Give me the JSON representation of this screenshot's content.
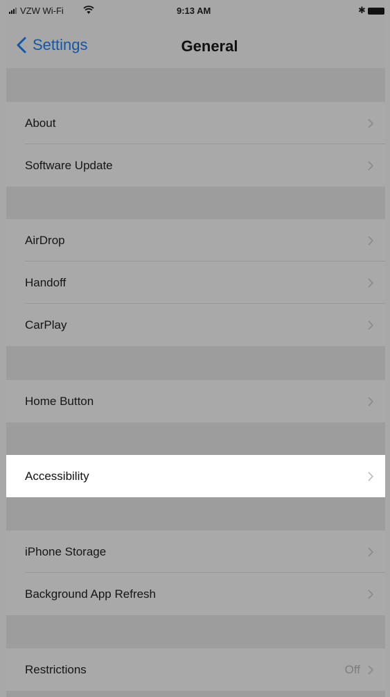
{
  "status_bar": {
    "carrier": "VZW Wi-Fi",
    "time": "9:13 AM",
    "icons": [
      "signal-icon",
      "wifi-icon",
      "bluetooth-icon",
      "battery-icon"
    ]
  },
  "nav_bar": {
    "back_label": "Settings",
    "title": "General",
    "accent_color": "#1456a7"
  },
  "groups": [
    {
      "items": [
        {
          "label": "About"
        },
        {
          "label": "Software Update"
        }
      ]
    },
    {
      "items": [
        {
          "label": "AirDrop"
        },
        {
          "label": "Handoff"
        },
        {
          "label": "CarPlay"
        }
      ]
    },
    {
      "items": [
        {
          "label": "Home Button"
        }
      ]
    },
    {
      "items": [
        {
          "label": "Accessibility",
          "highlighted": true
        }
      ]
    },
    {
      "items": [
        {
          "label": "iPhone Storage"
        },
        {
          "label": "Background App Refresh"
        }
      ]
    },
    {
      "items": [
        {
          "label": "Restrictions",
          "value": "Off"
        }
      ]
    }
  ]
}
